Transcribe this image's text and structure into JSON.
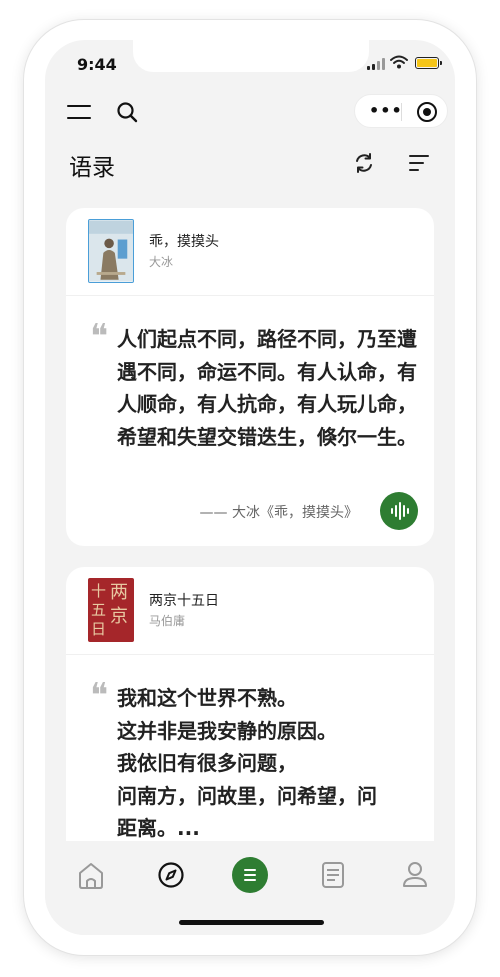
{
  "status_bar": {
    "time": "9:44"
  },
  "header": {
    "title": "语录"
  },
  "icons": {
    "menu": "menu-icon",
    "search": "search-icon",
    "more": "more-dots-icon",
    "target": "target-icon",
    "refresh": "refresh-icon",
    "sort": "sort-icon",
    "audio": "waveform-icon"
  },
  "capsule": {
    "more_label": "•••"
  },
  "quotes": [
    {
      "book_title": "乖，摸摸头",
      "author": "大冰",
      "quote_mark": "❝",
      "text": "人们起点不同，路径不同，乃至遭遇不同，命运不同。有人认命，有人顺命，有人抗命，有人玩儿命，希望和失望交错迭生，倏尔一生。",
      "source": "—— 大冰《乖，摸摸头》"
    },
    {
      "book_title": "两京十五日",
      "author": "马伯庸",
      "quote_mark": "❝",
      "text_lines": [
        "我和这个世界不熟。",
        "这并非是我安静的原因。",
        "我依旧有很多问题，",
        "问南方，问故里，问希望，问",
        "距离。..."
      ]
    }
  ],
  "tabbar": {
    "items": [
      "home-icon",
      "compass-icon",
      "quotes-icon",
      "notes-icon",
      "profile-icon"
    ],
    "active": "quotes-icon"
  },
  "colors": {
    "accent": "#2e7d32",
    "background": "#f3f3f3",
    "card": "#ffffff",
    "battery": "#f5c518"
  }
}
